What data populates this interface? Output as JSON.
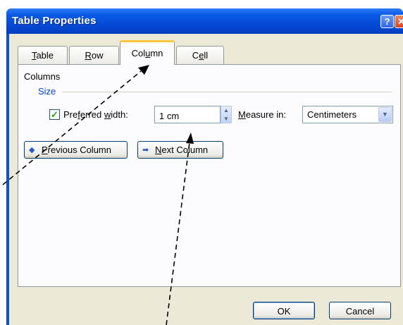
{
  "window": {
    "title": "Table Properties",
    "help_glyph": "?",
    "close_glyph": "✕"
  },
  "tabs": [
    {
      "label_pre": "",
      "label_key": "T",
      "label_post": "able",
      "selected": false
    },
    {
      "label_pre": "",
      "label_key": "R",
      "label_post": "ow",
      "selected": false
    },
    {
      "label_pre": "Col",
      "label_key": "u",
      "label_post": "mn",
      "selected": true
    },
    {
      "label_pre": "C",
      "label_key": "e",
      "label_post": "ll",
      "selected": false
    }
  ],
  "panel": {
    "group_label": "Columns",
    "size_label": "Size",
    "preferred_width": {
      "checked": true,
      "label_pre": "Pre",
      "label_key": "f",
      "label_mid": "erred ",
      "label_key2": "w",
      "label_post": "idth:",
      "value": "1 cm"
    },
    "measure_in": {
      "label_key": "M",
      "label_post": "easure in:",
      "value": "Centimeters"
    },
    "previous_column": {
      "label_key": "P",
      "label_post": "revious Column"
    },
    "next_column": {
      "label_key": "N",
      "label_post": "ext Column"
    }
  },
  "footer": {
    "ok_label": "OK",
    "cancel_label": "Cancel"
  },
  "colors": {
    "title_bar": "#0a50d8",
    "dialog_face": "#ece9d8",
    "tab_highlight": "#ffc83c",
    "group_accent": "#0046d5"
  }
}
